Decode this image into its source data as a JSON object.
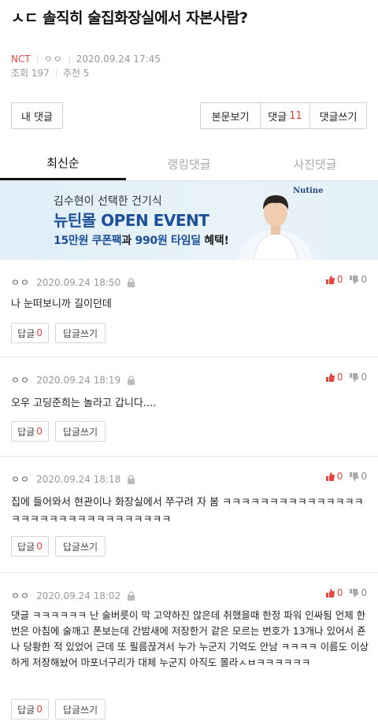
{
  "post": {
    "title": "ㅅㄷ 솔직히 술집화장실에서 자본사람?",
    "category": "NCT",
    "author": "ㅇㅇ",
    "date": "2020.09.24 17:45",
    "views_label": "조회 197",
    "likes_label": "추천 5"
  },
  "toolbar": {
    "my_comments": "내 댓글",
    "view_post": "본문보기",
    "comments_label": "댓글",
    "comments_count": "11",
    "write_comment": "댓글쓰기"
  },
  "tabs": [
    "최신순",
    "랭킹댓글",
    "사진댓글"
  ],
  "banner": {
    "line1": "김수현이 선택한 건기식",
    "line2": "뉴틴몰 OPEN EVENT",
    "line3_a": "15만원 쿠폰팩",
    "line3_b": "과 ",
    "line3_c": "990원 타임딜",
    "line3_d": " 혜택!",
    "brand": "Nutine"
  },
  "comments": [
    {
      "nick": "ㅇㅇ",
      "date": "2020.09.24 18:50",
      "text": "나 눈떠보니까 길이던데",
      "up": "0",
      "down": "0",
      "reply_label": "답글",
      "reply_count": "0",
      "write_label": "답글쓰기"
    },
    {
      "nick": "ㅇㅇ",
      "date": "2020.09.24 18:19",
      "text": "오우 고딩준희는 놀라고 갑니다....",
      "up": "0",
      "down": "0",
      "reply_label": "답글",
      "reply_count": "0",
      "write_label": "답글쓰기"
    },
    {
      "nick": "ㅇㅇ",
      "date": "2020.09.24 18:18",
      "text": "집에 들어와서 현관이나 화장실에서 쭈구려 자 봄 ㅋㅋㅋㅋㅋㅋㅋㅋㅋㅋㅋㅋㅋㅋㅋㅋㅋㅋㅋㅋㅋㅋㅋㅋㅋㅋㅋㅋㅋㅋㅋㅋ",
      "up": "0",
      "down": "0",
      "reply_label": "답글",
      "reply_count": "0",
      "write_label": "답글쓰기"
    },
    {
      "nick": "ㅇㅇ",
      "date": "2020.09.24 18:02",
      "text": "댓글 ㅋㅋㅋㅋㅋㅋ 난 술버릇이 막 고약하진 않은데 취했을때 한정 파워 인싸됨 언제 한번은 아침에 술깨고 폰보는데 간밤새에 저장한거 같은 모르는 번호가 13개나 있어서 죤나 당황한 적 있었어 근데 또 필름끊겨서 누가 누군지 기억도 안남 ㅋㅋㅋㅋ 이름도 이상하게 저장해놨어 마포너구리가 대체 누군지 아직도 몰라ㅅㅂㅋㅋㅋㅋㅋㅋ",
      "up": "0",
      "down": "0",
      "reply_label": "답글",
      "reply_count": "0",
      "write_label": "답글쓰기"
    }
  ],
  "colors": {
    "accent": "#e5463d",
    "banner_blue": "#1e4f9a"
  },
  "icons": {
    "lock": "lock-icon",
    "thumb_up": "thumbs-up-icon",
    "thumb_down": "thumbs-down-icon"
  }
}
